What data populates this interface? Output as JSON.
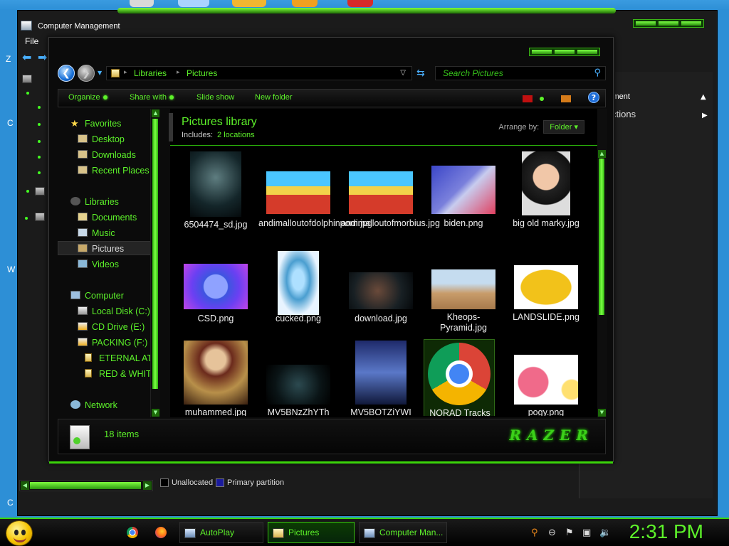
{
  "computer_management": {
    "title": "Computer Management",
    "menu_file": "File",
    "actions_header": "nagement",
    "more_actions": "re Actions",
    "legend_unallocated": "Unallocated",
    "legend_primary": "Primary partition",
    "side_fragments": [
      "Z",
      "C",
      "W",
      "C"
    ]
  },
  "explorer": {
    "breadcrumb": [
      "Libraries",
      "Pictures"
    ],
    "search_placeholder": "Search Pictures",
    "toolbar": {
      "organize": "Organize",
      "share_with": "Share with",
      "slide_show": "Slide show",
      "new_folder": "New folder",
      "help": "?"
    },
    "nav": {
      "favorites": "Favorites",
      "desktop": "Desktop",
      "downloads": "Downloads",
      "recent_places": "Recent Places",
      "libraries": "Libraries",
      "documents": "Documents",
      "music": "Music",
      "pictures": "Pictures",
      "videos": "Videos",
      "computer": "Computer",
      "local_disk": "Local Disk (C:)",
      "cd_drive": "CD Drive (E:)",
      "packing": "PACKING (F:)",
      "eternal": "ETERNAL ATA",
      "red_white": "RED & WHITE",
      "network": "Network"
    },
    "library": {
      "title": "Pictures library",
      "includes_label": "Includes:",
      "locations_link": "2 locations",
      "arrange_label": "Arrange by:",
      "arrange_value": "Folder"
    },
    "files": [
      {
        "name": "6504474_sd.jpg",
        "icon": "movie-poster-thumbnail"
      },
      {
        "name": "andimalloutofdolphinporn.jpg",
        "icon": "cartoon-thumbnail"
      },
      {
        "name": "andimalloutofmorbius.jpg",
        "icon": "cartoon-thumbnail"
      },
      {
        "name": "biden.png",
        "icon": "photo-thumbnail"
      },
      {
        "name": "big old marky.jpg",
        "icon": "portrait-thumbnail"
      },
      {
        "name": "CSD.png",
        "icon": "badge-thumbnail"
      },
      {
        "name": "cucked.png",
        "icon": "figure-thumbnail"
      },
      {
        "name": "download.jpg",
        "icon": "dark-photo-thumbnail"
      },
      {
        "name": "Kheops-Pyramid.jpg",
        "icon": "pyramid-thumbnail"
      },
      {
        "name": "LANDSLIDE.png",
        "icon": "map-thumbnail"
      },
      {
        "name": "muhammed.jpg",
        "icon": "painting-thumbnail"
      },
      {
        "name": "MV5BNzZhYTh",
        "icon": "dark-photo-thumbnail"
      },
      {
        "name": "MV5BOTZiYWI",
        "icon": "movie-poster-thumbnail"
      },
      {
        "name": "NORAD Tracks",
        "icon": "chrome-shortcut-icon"
      },
      {
        "name": "pogy.png",
        "icon": "cartoon-thumbnail"
      }
    ],
    "item_count": "18 items",
    "logo": "RAZER"
  },
  "taskbar": {
    "buttons": [
      {
        "label": "AutoPlay"
      },
      {
        "label": "Pictures"
      },
      {
        "label": "Computer Man..."
      }
    ],
    "clock": "2:31 PM"
  }
}
